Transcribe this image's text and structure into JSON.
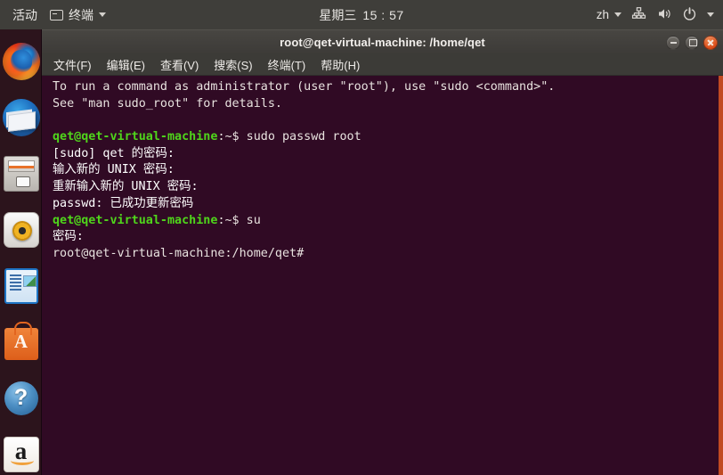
{
  "topbar": {
    "activities_label": "活动",
    "app_menu_label": "终端",
    "app_menu_icon": "terminal-icon",
    "clock_day": "星期三",
    "clock_time": "15 : 57",
    "language_label": "zh",
    "network_icon": "network-wired-icon",
    "volume_icon": "volume-speaker-icon",
    "power_icon": "power-icon",
    "caret_icon": "chevron-down-icon"
  },
  "dock": {
    "items": [
      {
        "name": "firefox",
        "label": "Firefox",
        "icon": "firefox-icon"
      },
      {
        "name": "thunderbird",
        "label": "Thunderbird Mail",
        "icon": "mail-icon"
      },
      {
        "name": "files",
        "label": "Files",
        "icon": "file-manager-icon"
      },
      {
        "name": "rhythmbox",
        "label": "Rhythmbox",
        "icon": "music-player-icon"
      },
      {
        "name": "libreoffice-writer",
        "label": "LibreOffice Writer",
        "icon": "document-writer-icon"
      },
      {
        "name": "ubuntu-software",
        "label": "Ubuntu Software",
        "icon": "software-bag-icon"
      },
      {
        "name": "help",
        "label": "Help",
        "icon": "help-question-icon"
      },
      {
        "name": "amazon",
        "label": "Amazon",
        "icon": "amazon-icon"
      }
    ]
  },
  "window": {
    "title": "root@qet-virtual-machine: /home/qet",
    "controls": {
      "minimize": "minimize-button",
      "maximize": "maximize-button",
      "close": "close-button"
    },
    "menu": [
      {
        "label": "文件(F)",
        "name": "menu-file"
      },
      {
        "label": "编辑(E)",
        "name": "menu-edit"
      },
      {
        "label": "查看(V)",
        "name": "menu-view"
      },
      {
        "label": "搜索(S)",
        "name": "menu-search"
      },
      {
        "label": "终端(T)",
        "name": "menu-terminal"
      },
      {
        "label": "帮助(H)",
        "name": "menu-help"
      }
    ]
  },
  "terminal": {
    "colors": {
      "background": "#300a24",
      "foreground": "#e8e2df",
      "prompt_green": "#4fd51b",
      "scrollbar": "#c14a22"
    },
    "lines": [
      {
        "segments": [
          {
            "text": "To run a command as administrator (user \"root\"), use \"sudo <command>\".",
            "style": "plain"
          }
        ]
      },
      {
        "segments": [
          {
            "text": "See \"man sudo_root\" for details.",
            "style": "plain"
          }
        ]
      },
      {
        "segments": [
          {
            "text": "",
            "style": "plain"
          }
        ]
      },
      {
        "segments": [
          {
            "text": "qet@qet-virtual-machine",
            "style": "green"
          },
          {
            "text": ":~$ sudo passwd root",
            "style": "plain"
          }
        ]
      },
      {
        "segments": [
          {
            "text": "[sudo] qet 的密码:",
            "style": "white"
          }
        ]
      },
      {
        "segments": [
          {
            "text": "输入新的 UNIX 密码:",
            "style": "white"
          }
        ]
      },
      {
        "segments": [
          {
            "text": "重新输入新的 UNIX 密码:",
            "style": "white"
          }
        ]
      },
      {
        "segments": [
          {
            "text": "passwd: 已成功更新密码",
            "style": "white"
          }
        ]
      },
      {
        "segments": [
          {
            "text": "qet@qet-virtual-machine",
            "style": "green"
          },
          {
            "text": ":~$ su",
            "style": "plain"
          }
        ]
      },
      {
        "segments": [
          {
            "text": "密码:",
            "style": "white"
          }
        ]
      },
      {
        "segments": [
          {
            "text": "root@qet-virtual-machine:/home/qet#",
            "style": "plain"
          }
        ]
      }
    ]
  }
}
